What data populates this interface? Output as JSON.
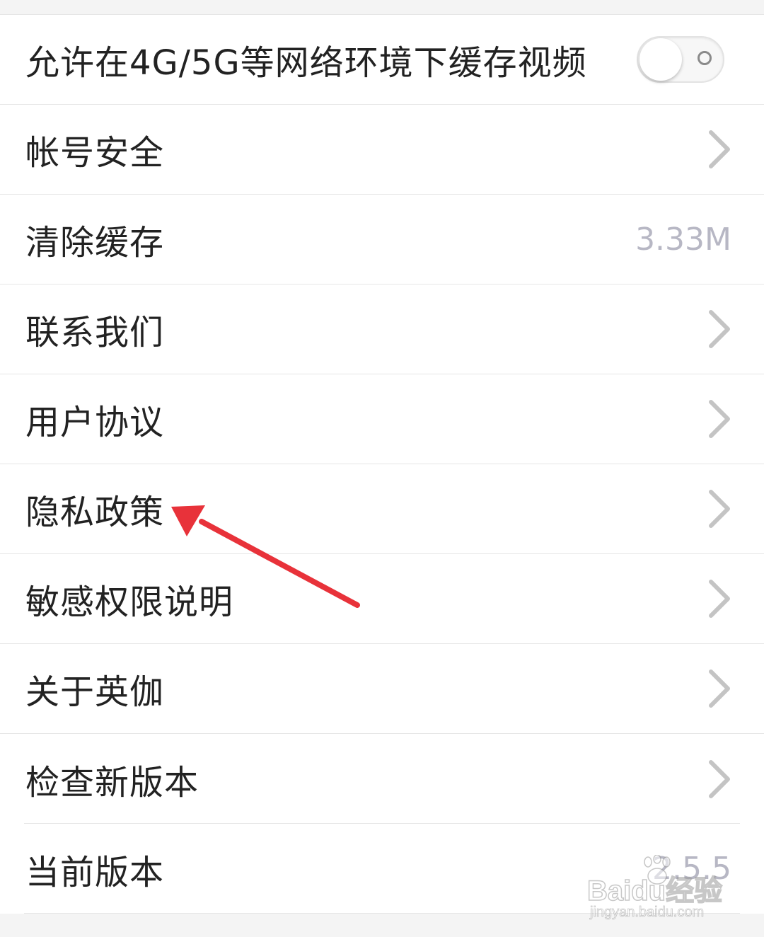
{
  "settings": {
    "items": [
      {
        "label": "允许在4G/5G等网络环境下缓存视频",
        "control": "toggle",
        "toggle_on": false
      },
      {
        "label": "帐号安全",
        "control": "chevron"
      },
      {
        "label": "清除缓存",
        "control": "value",
        "value": "3.33M"
      },
      {
        "label": "联系我们",
        "control": "chevron"
      },
      {
        "label": "用户协议",
        "control": "chevron"
      },
      {
        "label": "隐私政策",
        "control": "chevron"
      },
      {
        "label": "敏感权限说明",
        "control": "chevron"
      },
      {
        "label": "关于英伽",
        "control": "chevron"
      },
      {
        "label": "检查新版本",
        "control": "chevron"
      },
      {
        "label": "当前版本",
        "control": "value",
        "value": "2.5.5"
      }
    ]
  },
  "annotation": {
    "color": "#e8323a",
    "points_to": "隐私政策"
  },
  "watermark": {
    "main": "Baidu经验",
    "sub": "jingyan.baidu.com"
  },
  "icons": {
    "chevron": "chevron-right-icon",
    "arrow": "red-arrow-icon"
  }
}
